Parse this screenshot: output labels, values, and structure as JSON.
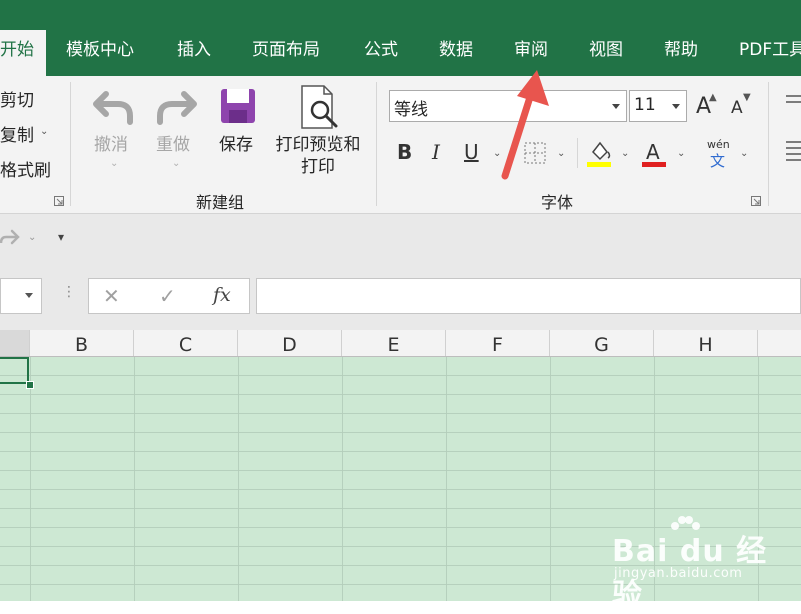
{
  "tabs": [
    {
      "label": "开始",
      "active": true
    },
    {
      "label": "模板中心"
    },
    {
      "label": "插入"
    },
    {
      "label": "页面布局"
    },
    {
      "label": "公式"
    },
    {
      "label": "数据"
    },
    {
      "label": "审阅"
    },
    {
      "label": "视图"
    },
    {
      "label": "帮助"
    },
    {
      "label": "PDF工具"
    }
  ],
  "clipboard": {
    "cut": "剪切",
    "copy": "复制",
    "format_painter": "格式刷"
  },
  "new_group": {
    "undo": "撤消",
    "redo": "重做",
    "save": "保存",
    "print_preview_line1": "打印预览和",
    "print_preview_line2": "打印",
    "group_label": "新建组"
  },
  "font": {
    "name": "等线",
    "size": "11",
    "grow": "A",
    "shrink": "A",
    "bold": "B",
    "italic": "I",
    "underline": "U",
    "phonetic_top": "wén",
    "phonetic_bottom": "文",
    "group_label": "字体"
  },
  "formula_bar": {
    "cancel": "✕",
    "enter": "✓",
    "fx": "fx",
    "value": ""
  },
  "columns": [
    "B",
    "C",
    "D",
    "E",
    "F",
    "G",
    "H"
  ],
  "colors": {
    "brand": "#217346",
    "highlight": "#ffff00",
    "font_color": "#e02020",
    "arrow": "#e8554e"
  },
  "watermark": {
    "main": "Bai du 经验",
    "sub": "jingyan.baidu.com"
  }
}
